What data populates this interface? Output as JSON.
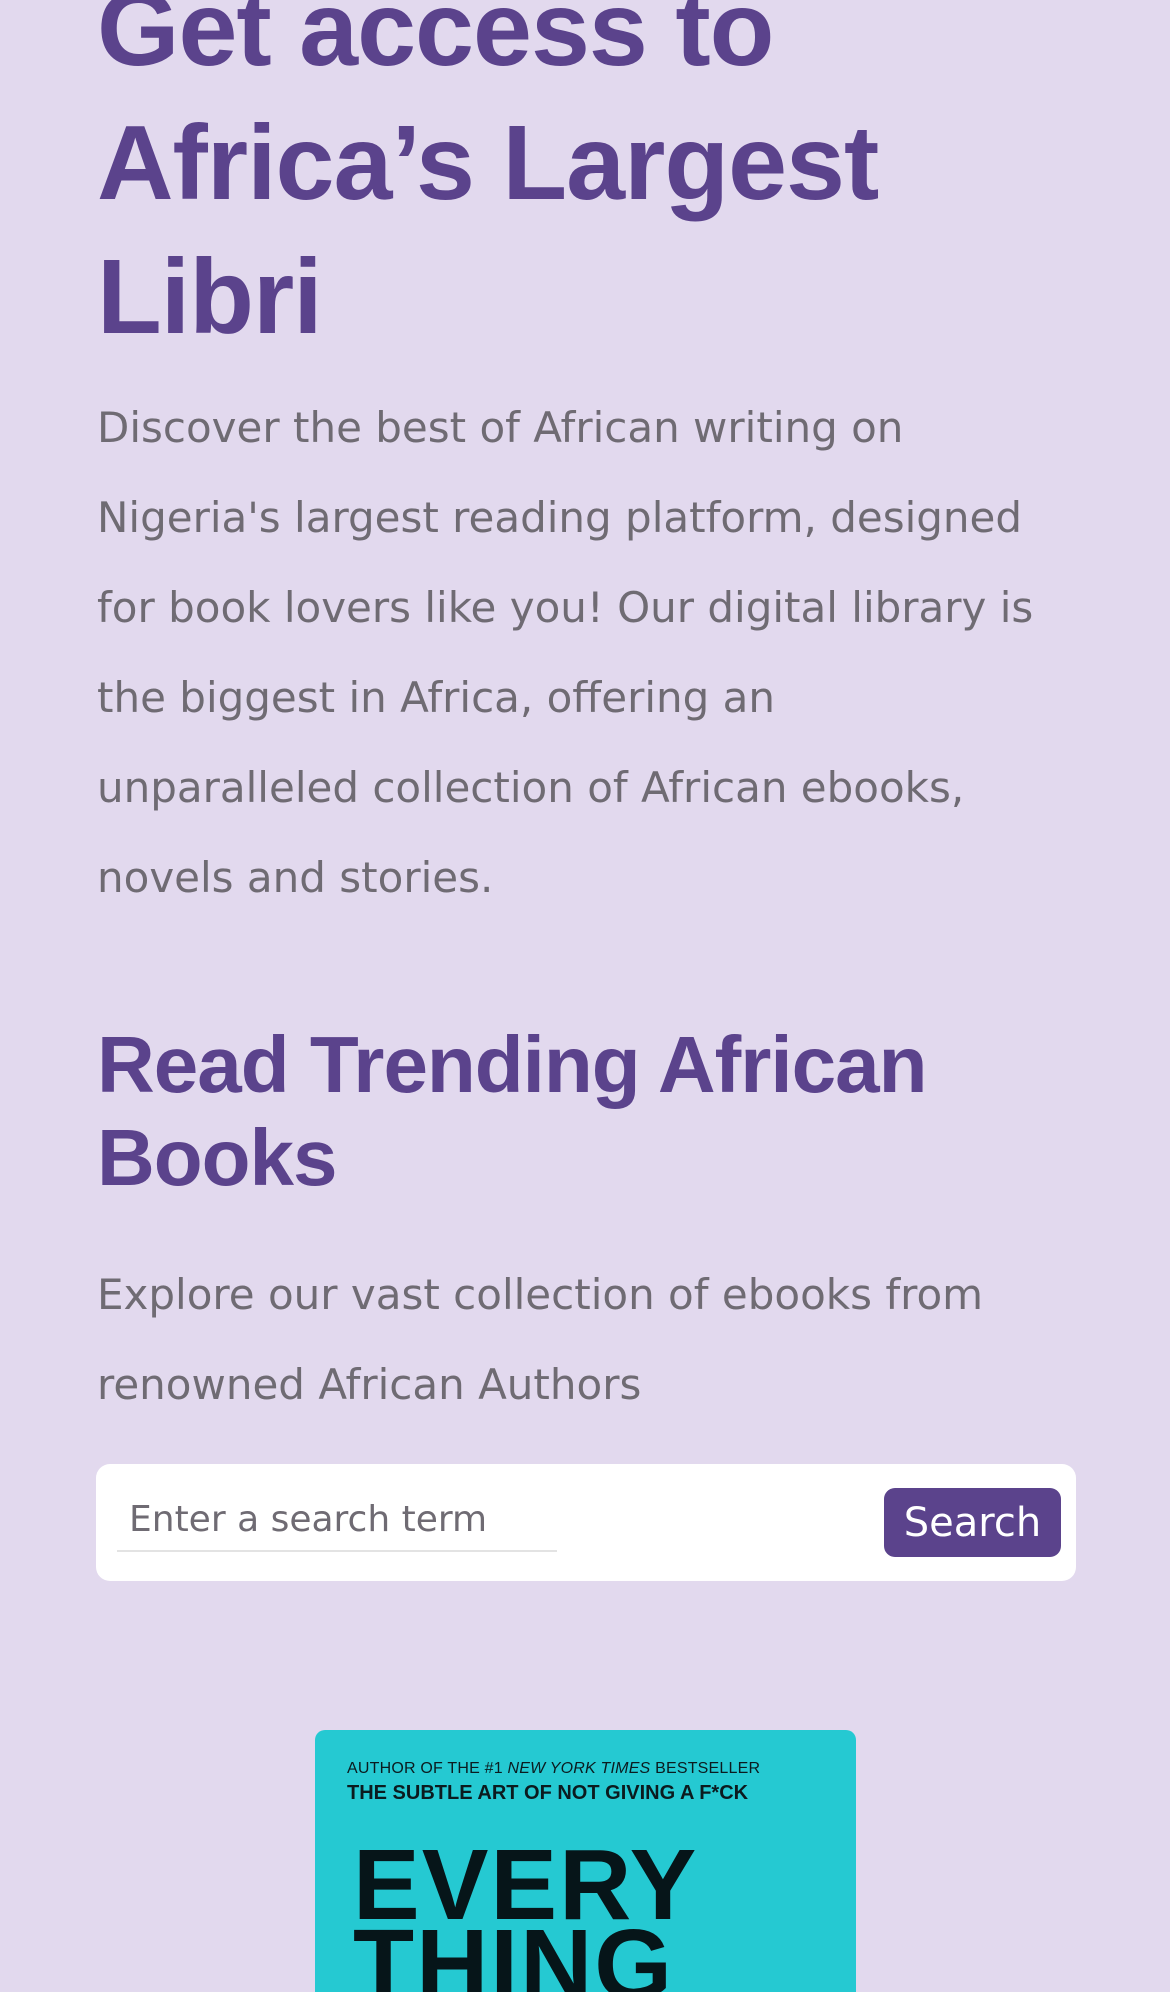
{
  "hero": {
    "title": "Get access to\nAfrica’s Largest\nLibri",
    "description": "Discover the best of African writing on\nNigeria's largest reading platform, designed\nfor book lovers like you! Our digital library is\nthe biggest in Africa, offering an\nunparalleled collection of African ebooks,\nnovels and stories."
  },
  "trending": {
    "title": "Read Trending African\nBooks",
    "subtitle": "Explore our vast collection of ebooks from\nrenowned African Authors"
  },
  "search": {
    "placeholder": "Enter a search term",
    "value": "",
    "button_label": "Search"
  },
  "book": {
    "cover_line1_prefix": "AUTHOR OF THE #1 ",
    "cover_line1_em": "NEW YORK TIMES",
    "cover_line1_suffix": " BESTSELLER",
    "cover_line2": "THE SUBTLE ART OF NOT GIVING A F*CK",
    "cover_title": "EVERY\nTHING",
    "cover_color": "#25c9d2"
  },
  "colors": {
    "background": "#e2d9ee",
    "accent": "#5b438c",
    "body_text": "#6f6b73"
  }
}
